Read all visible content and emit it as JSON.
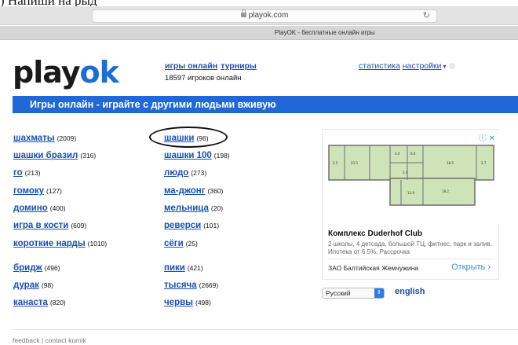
{
  "chrome": {
    "cut_text": ") Напиши на рыд",
    "url": "playok.com",
    "reload_glyph": "↻",
    "tab_title": "PlayOK - бесплатные онлайн игры"
  },
  "header": {
    "logo_part1": "play",
    "logo_part2": "ok",
    "link_games": "игры онлайн",
    "link_tournaments": "турниры",
    "online_count": "18597 игроков онлайн",
    "link_stats": "статистика",
    "link_settings": "настройки",
    "settings_caret": "▾"
  },
  "banner": {
    "text": "Игры онлайн - играйте с другими людьми вживую"
  },
  "games": {
    "left": [
      {
        "name": "шахматы",
        "count": "(2009)"
      },
      {
        "name": "шашки бразил",
        "count": "(316)"
      },
      {
        "name": "го",
        "count": "(213)"
      },
      {
        "name": "гомоку",
        "count": "(127)"
      },
      {
        "name": "домино",
        "count": "(400)"
      },
      {
        "name": "игра в кости",
        "count": "(609)"
      },
      {
        "name": "короткие нарды",
        "count": "(1010)"
      },
      {
        "name": "бридж",
        "count": "(496)"
      },
      {
        "name": "дурак",
        "count": "(98)"
      },
      {
        "name": "канаста",
        "count": "(820)"
      }
    ],
    "right": [
      {
        "name": "шашки",
        "count": "(96)"
      },
      {
        "name": "шашки 100",
        "count": "(198)"
      },
      {
        "name": "людо",
        "count": "(273)"
      },
      {
        "name": "ма-джонг",
        "count": "(360)"
      },
      {
        "name": "мельница",
        "count": "(20)"
      },
      {
        "name": "реверси",
        "count": "(101)"
      },
      {
        "name": "сёги",
        "count": "(25)"
      },
      {
        "name": "пики",
        "count": "(421)"
      },
      {
        "name": "тысяча",
        "count": "(2669)"
      },
      {
        "name": "червы",
        "count": "(498)"
      }
    ]
  },
  "ad": {
    "info_icon": "ⓘ ✕",
    "plan_labels": [
      "2.5",
      "23.5",
      "4.4",
      "8.6",
      "18.5",
      "2.7",
      "2.4",
      "12.9",
      "18.2"
    ],
    "title": "Комплекс Duderhof Club",
    "description": "2 школы, 4 детсада, большой ТЦ, фитнес, парк и залив. Ипотека от 6.5%. Рассрочка",
    "sponsor": "ЗАО Балтийская Жемчужина",
    "cta": "Открыть",
    "cta_arrow": "›"
  },
  "language": {
    "selected": "Русский",
    "arrow": "⇕",
    "alt": "english"
  },
  "footer": {
    "text": "feedback | contact  kurnik"
  },
  "colors": {
    "accent": "#1f68d6",
    "link": "#1a4fb4",
    "logo_ok": "#1a6fd6"
  }
}
